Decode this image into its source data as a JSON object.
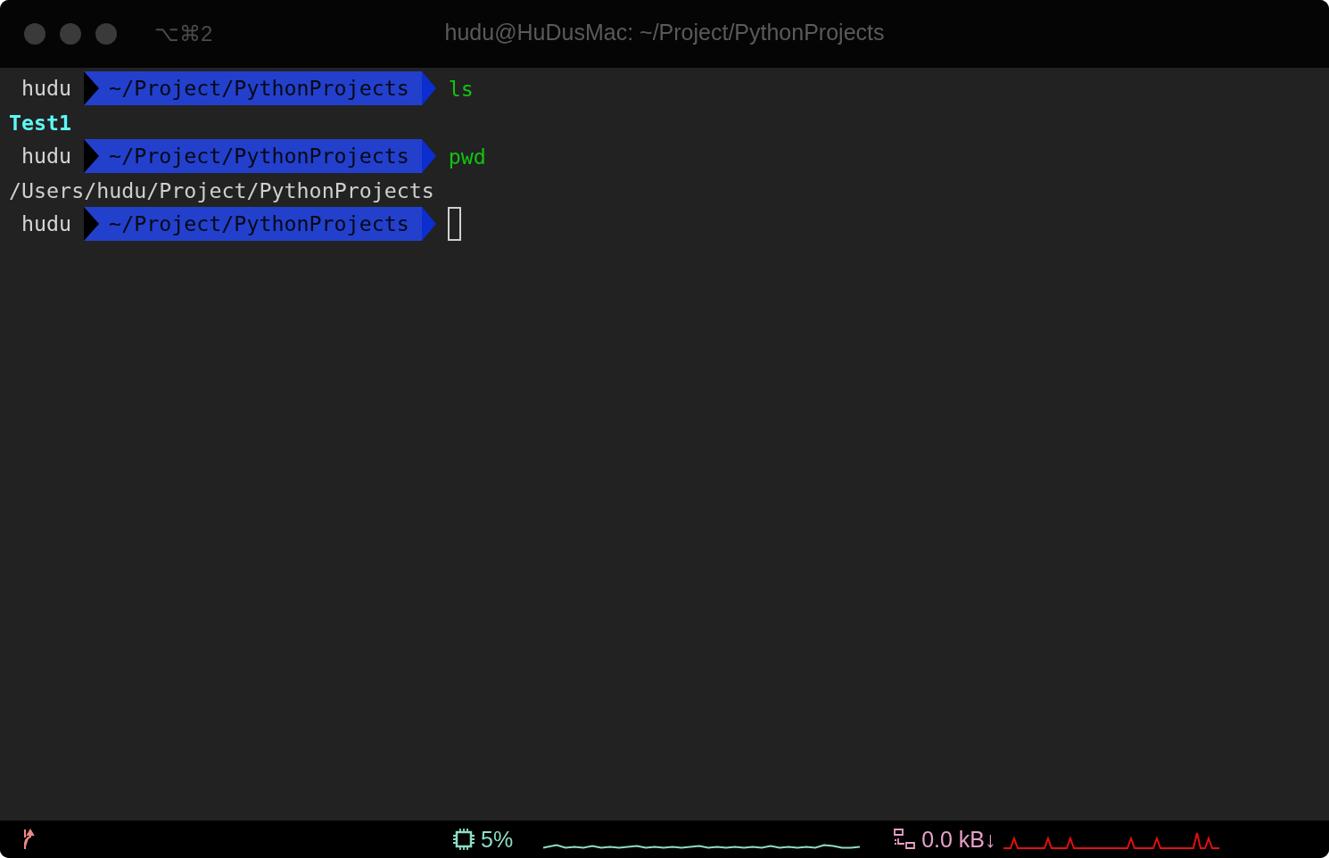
{
  "window": {
    "shortcut": "⌥⌘2",
    "title": "hudu@HuDusMac: ~/Project/PythonProjects"
  },
  "lines": [
    {
      "kind": "prompt",
      "user": "hudu",
      "path": "~/Project/PythonProjects",
      "command": "ls",
      "cursor": false
    },
    {
      "kind": "directory",
      "text": "Test1"
    },
    {
      "kind": "prompt",
      "user": "hudu",
      "path": "~/Project/PythonProjects",
      "command": "pwd",
      "cursor": false
    },
    {
      "kind": "output",
      "text": "/Users/hudu/Project/PythonProjects"
    },
    {
      "kind": "prompt",
      "user": "hudu",
      "path": "~/Project/PythonProjects",
      "cursor": true
    }
  ],
  "status_bar": {
    "cpu": "5%",
    "network": "0.0 kB↓"
  }
}
